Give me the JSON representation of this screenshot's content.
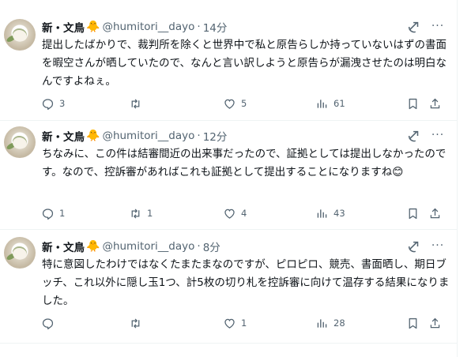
{
  "tweets": [
    {
      "author_name": "新・文鳥",
      "author_emoji": "🐥",
      "handle": "@humitori__dayo",
      "separator": "·",
      "time": "14分",
      "text": "提出したばかりで、裁判所を除くと世界中で私と原告らしか持っていないはずの書面を暇空さんが晒していたので、なんと言い訳しようと原告らが漏洩させたのは明白なんですよねぇ。",
      "replies": "3",
      "retweets": "",
      "likes": "5",
      "views": "61"
    },
    {
      "author_name": "新・文鳥",
      "author_emoji": "🐥",
      "handle": "@humitori__dayo",
      "separator": "·",
      "time": "12分",
      "text": "ちなみに、この件は結審間近の出来事だったので、証拠としては提出しなかったのです。なので、控訴審があればこれも証拠として提出することになりますね😊",
      "replies": "1",
      "retweets": "1",
      "likes": "4",
      "views": "43"
    },
    {
      "author_name": "新・文鳥",
      "author_emoji": "🐥",
      "handle": "@humitori__dayo",
      "separator": "·",
      "time": "8分",
      "text": "特に意図したわけではなくたまたまなのですが、ピロピロ、競売、書面晒し、期日ブッチ、これ以外に隠し玉1つ、計5枚の切り札を控訴審に向けて温存する結果になりました。",
      "replies": "",
      "retweets": "",
      "likes": "1",
      "views": "28"
    }
  ],
  "icons": {
    "grok": "grok-icon",
    "more": "more-icon",
    "reply": "reply-icon",
    "retweet": "retweet-icon",
    "like": "like-icon",
    "views": "views-icon",
    "bookmark": "bookmark-icon",
    "share": "share-icon"
  },
  "colors": {
    "text": "#0f1419",
    "secondary": "#536471",
    "divider": "#eff3f4"
  }
}
